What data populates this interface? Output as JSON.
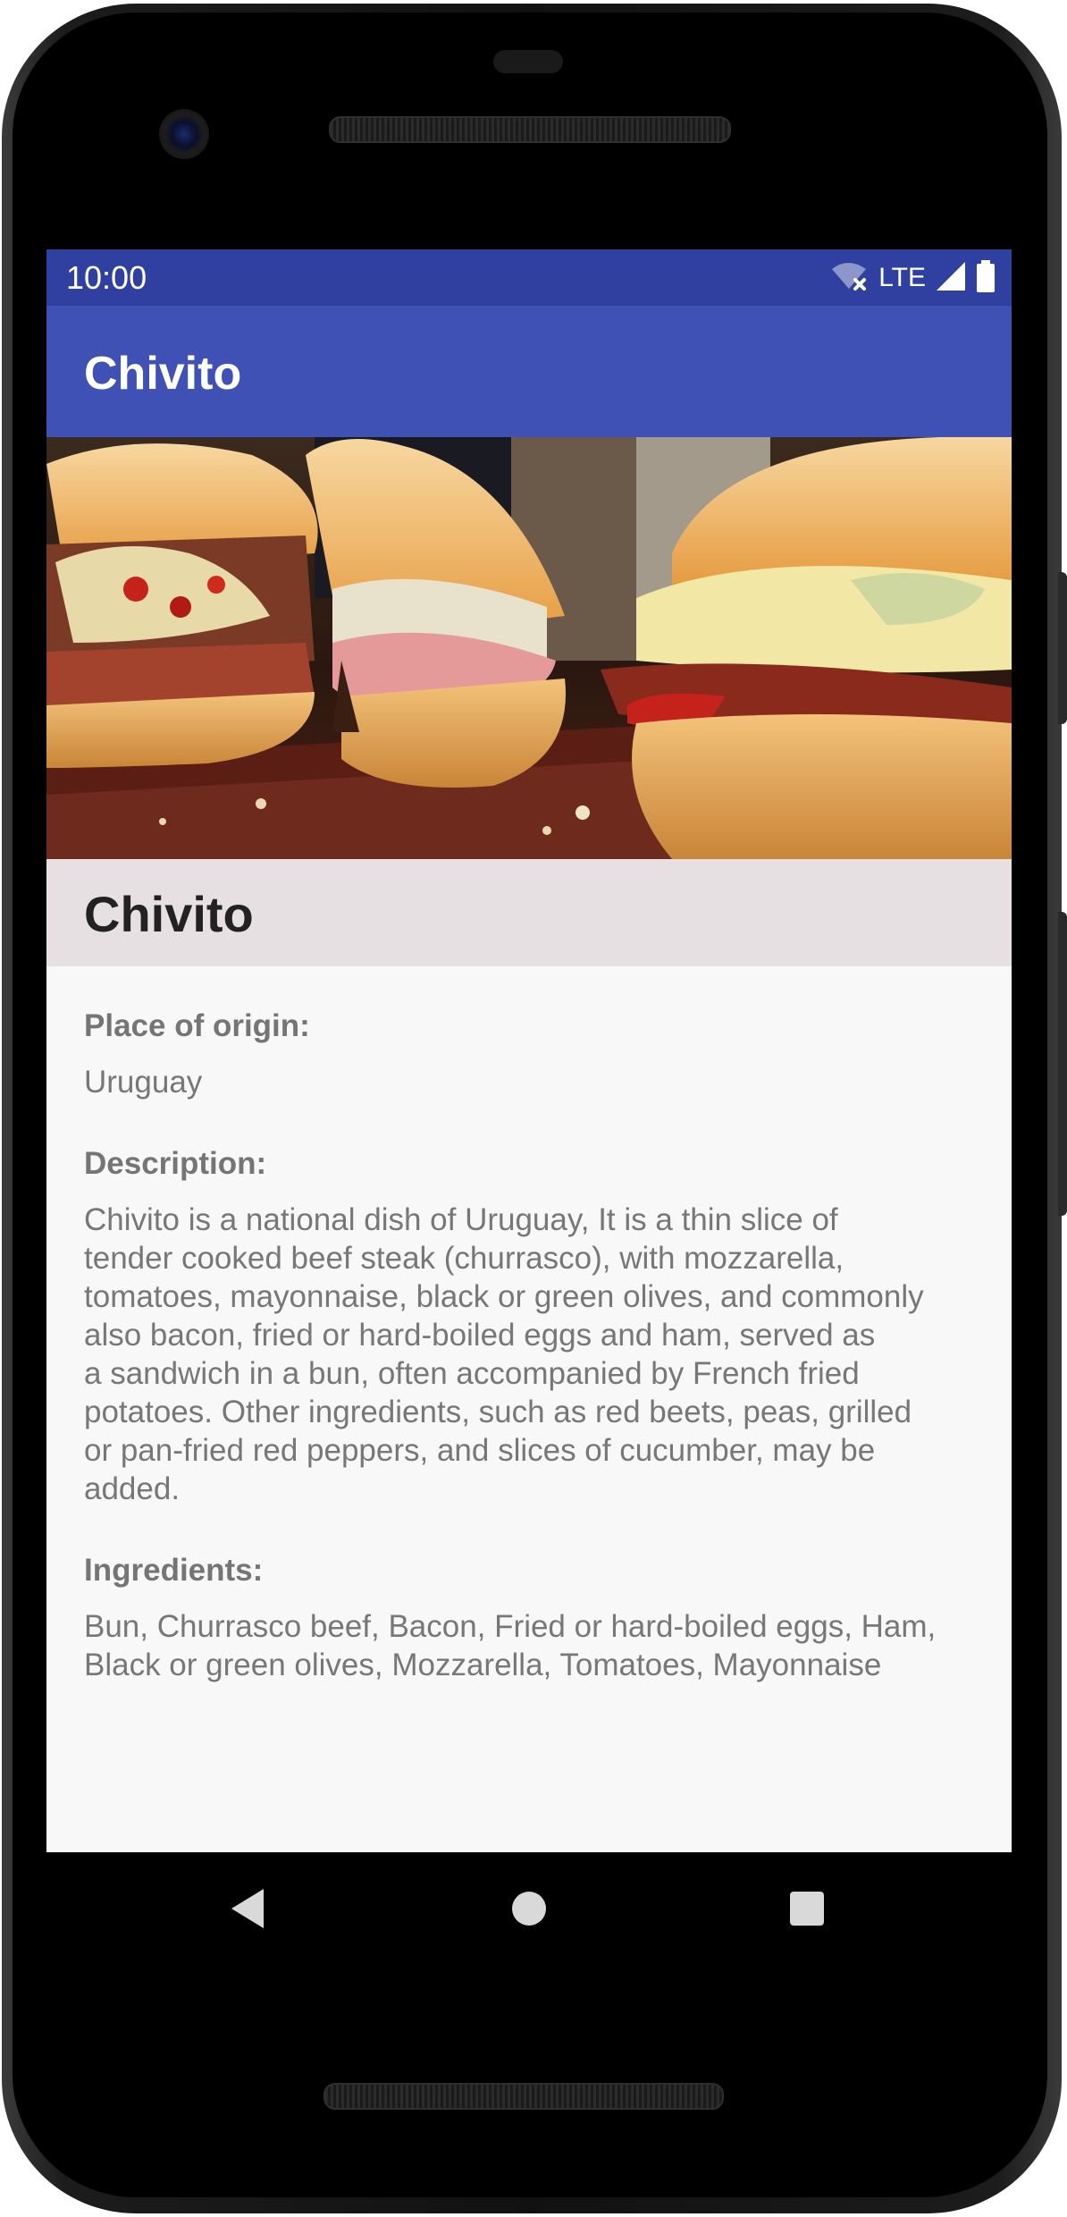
{
  "status_bar": {
    "time": "10:00",
    "network": "LTE",
    "icons": [
      "wifi-off-icon",
      "signal-icon",
      "battery-icon"
    ]
  },
  "app_bar": {
    "title": "Chivito"
  },
  "hero_image": {
    "icon": "chivito-sandwich-photo"
  },
  "dish": {
    "name": "Chivito",
    "origin_label": "Place of origin:",
    "origin": "Uruguay",
    "description_label": "Description:",
    "description_lines": [
      "Chivito is a national dish of Uruguay, It is a thin slice of",
      "tender cooked beef steak (churrasco), with mozzarella,",
      "tomatoes, mayonnaise, black or green olives, and commonly",
      "also bacon, fried or hard-boiled eggs and ham, served as",
      "a sandwich in a bun, often accompanied by French fried",
      "potatoes. Other ingredients, such as red beets, peas, grilled",
      "or pan-fried red peppers, and slices of cucumber, may be",
      "added."
    ],
    "ingredients_label": "Ingredients:",
    "ingredients_lines": [
      "Bun, Churrasco beef, Bacon, Fried or hard-boiled eggs, Ham,",
      "Black or green olives, Mozzarella, Tomatoes, Mayonnaise"
    ]
  },
  "navigation": {
    "back": "back-icon",
    "home": "home-icon",
    "recents": "recents-icon"
  },
  "colors": {
    "status_bar": "#3040a0",
    "app_bar": "#3f51b5",
    "name_band": "#e6e0e2",
    "content_bg": "#f8f8f8",
    "label_text": "#757575"
  }
}
